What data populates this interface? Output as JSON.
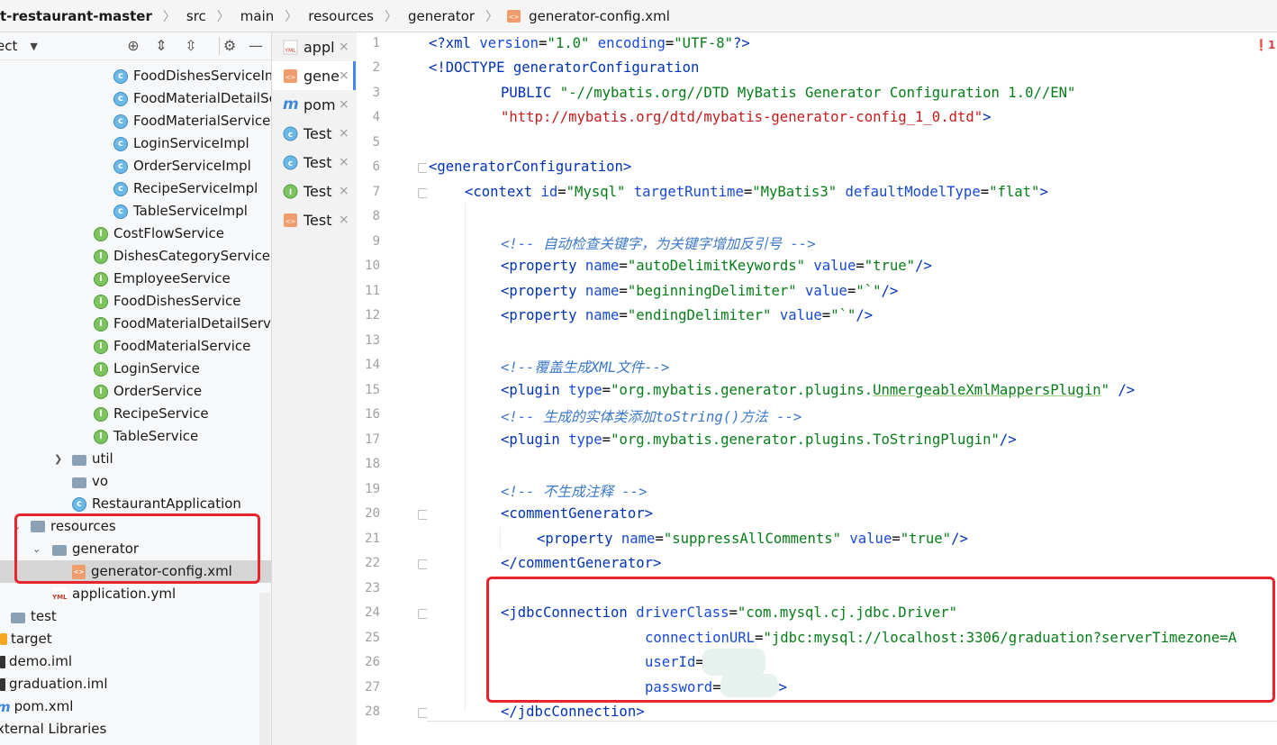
{
  "breadcrumb": [
    "t-restaurant-master",
    "src",
    "main",
    "resources",
    "generator",
    "generator-config.xml"
  ],
  "project_panel": {
    "title": "ect",
    "icons": [
      "crosshair-icon",
      "expand-all-icon",
      "collapse-all-icon",
      "gear-icon",
      "minimize-icon"
    ],
    "tree": [
      {
        "label": "FoodDishesServiceIm",
        "icon": "class"
      },
      {
        "label": "FoodMaterialDetailSe",
        "icon": "class"
      },
      {
        "label": "FoodMaterialServiceI",
        "icon": "class"
      },
      {
        "label": "LoginServiceImpl",
        "icon": "class"
      },
      {
        "label": "OrderServiceImpl",
        "icon": "class"
      },
      {
        "label": "RecipeServiceImpl",
        "icon": "class"
      },
      {
        "label": "TableServiceImpl",
        "icon": "class"
      },
      {
        "label": "CostFlowService",
        "icon": "interface"
      },
      {
        "label": "DishesCategoryService",
        "icon": "interface"
      },
      {
        "label": "EmployeeService",
        "icon": "interface"
      },
      {
        "label": "FoodDishesService",
        "icon": "interface"
      },
      {
        "label": "FoodMaterialDetailServi",
        "icon": "interface"
      },
      {
        "label": "FoodMaterialService",
        "icon": "interface"
      },
      {
        "label": "LoginService",
        "icon": "interface"
      },
      {
        "label": "OrderService",
        "icon": "interface"
      },
      {
        "label": "RecipeService",
        "icon": "interface"
      },
      {
        "label": "TableService",
        "icon": "interface"
      },
      {
        "label": "util",
        "icon": "folder"
      },
      {
        "label": "vo",
        "icon": "folder"
      },
      {
        "label": "RestaurantApplication",
        "icon": "app-class"
      },
      {
        "label": "resources",
        "icon": "resources-folder"
      },
      {
        "label": "generator",
        "icon": "folder"
      },
      {
        "label": "generator-config.xml",
        "icon": "xml"
      },
      {
        "label": "application.yml",
        "icon": "yml"
      },
      {
        "label": "test",
        "icon": "folder"
      },
      {
        "label": "target",
        "icon": "target-folder"
      },
      {
        "label": "demo.iml",
        "icon": "iml"
      },
      {
        "label": "graduation.iml",
        "icon": "iml"
      },
      {
        "label": "pom.xml",
        "icon": "maven"
      },
      {
        "label": "xternal Libraries",
        "icon": "libraries"
      }
    ]
  },
  "tabs": [
    {
      "label": "appl",
      "icon": "yml"
    },
    {
      "label": "gene",
      "icon": "xml"
    },
    {
      "label": "pom",
      "icon": "maven"
    },
    {
      "label": "Test",
      "icon": "class"
    },
    {
      "label": "Test",
      "icon": "class"
    },
    {
      "label": "Test",
      "icon": "interface"
    },
    {
      "label": "Test",
      "icon": "xml"
    }
  ],
  "tab_close": "×",
  "error_badge": "❗1",
  "code": {
    "l1_a": "<?xml ",
    "l1_b": "version",
    "l1_c": "=",
    "l1_d": "\"1.0\"",
    "l1_e": " encoding",
    "l1_f": "=",
    "l1_g": "\"UTF-8\"",
    "l1_h": "?>",
    "l2_a": "<!DOCTYPE ",
    "l2_b": "generatorConfiguration",
    "l3_a": "PUBLIC ",
    "l3_b": "\"-//mybatis.org//DTD MyBatis Generator Configuration 1.0//EN\"",
    "l4_a": "\"http://mybatis.org/dtd/mybatis-generator-config_1_0.dtd\"",
    "l4_b": ">",
    "l6": "<generatorConfiguration>",
    "l7_a": "<context ",
    "l7_b": "id",
    "l7_c": "\"Mysql\"",
    "l7_d": " targetRuntime",
    "l7_e": "\"MyBatis3\"",
    "l7_f": " defaultModelType",
    "l7_g": "\"flat\"",
    "l7_h": ">",
    "l9": "<!-- 自动检查关键字，为关键字增加反引号 -->",
    "l10_a": "<property ",
    "l10_b": "name",
    "l10_c": "\"autoDelimitKeywords\"",
    "l10_d": " value",
    "l10_e": "\"true\"",
    "l10_f": "/>",
    "l11_a": "<property ",
    "l11_b": "name",
    "l11_c": "\"beginningDelimiter\"",
    "l11_d": " value",
    "l11_e": "\"`\"",
    "l11_f": "/>",
    "l12_a": "<property ",
    "l12_b": "name",
    "l12_c": "\"endingDelimiter\"",
    "l12_d": " value",
    "l12_e": "\"`\"",
    "l12_f": "/>",
    "l14": "<!--覆盖生成XML文件-->",
    "l15_a": "<plugin ",
    "l15_b": "type",
    "l15_c": "\"org.mybatis.generator.plugins.",
    "l15_d": "UnmergeableXmlMappersPlugin",
    "l15_e": "\"",
    "l15_f": " />",
    "l16": "<!-- 生成的实体类添加toString()方法 -->",
    "l17_a": "<plugin ",
    "l17_b": "type",
    "l17_c": "\"org.mybatis.generator.plugins.ToStringPlugin\"",
    "l17_d": "/>",
    "l19": "<!-- 不生成注释 -->",
    "l20": "<commentGenerator>",
    "l21_a": "<property ",
    "l21_b": "name",
    "l21_c": "\"suppressAllComments\"",
    "l21_d": " value",
    "l21_e": "\"true\"",
    "l21_f": "/>",
    "l22": "</commentGenerator>",
    "l24_a": "<jdbcConnection ",
    "l24_b": "driverClass",
    "l24_c": "\"com.mysql.cj.jdbc.Driver\"",
    "l25_a": "connectionURL",
    "l25_b": "\"jdbc:mysql://localhost:3306/graduation?serverTimezone=A",
    "l26_a": "userId",
    "l26_b": "=",
    "l27_a": "password",
    "l27_b": "=",
    "l27_c": ">",
    "l28": "</jdbcConnection>",
    "eq": "="
  },
  "line_numbers": [
    "1",
    "2",
    "3",
    "4",
    "5",
    "6",
    "7",
    "8",
    "9",
    "10",
    "11",
    "12",
    "13",
    "14",
    "15",
    "16",
    "17",
    "18",
    "19",
    "20",
    "21",
    "22",
    "23",
    "24",
    "25",
    "26",
    "27",
    "28"
  ]
}
